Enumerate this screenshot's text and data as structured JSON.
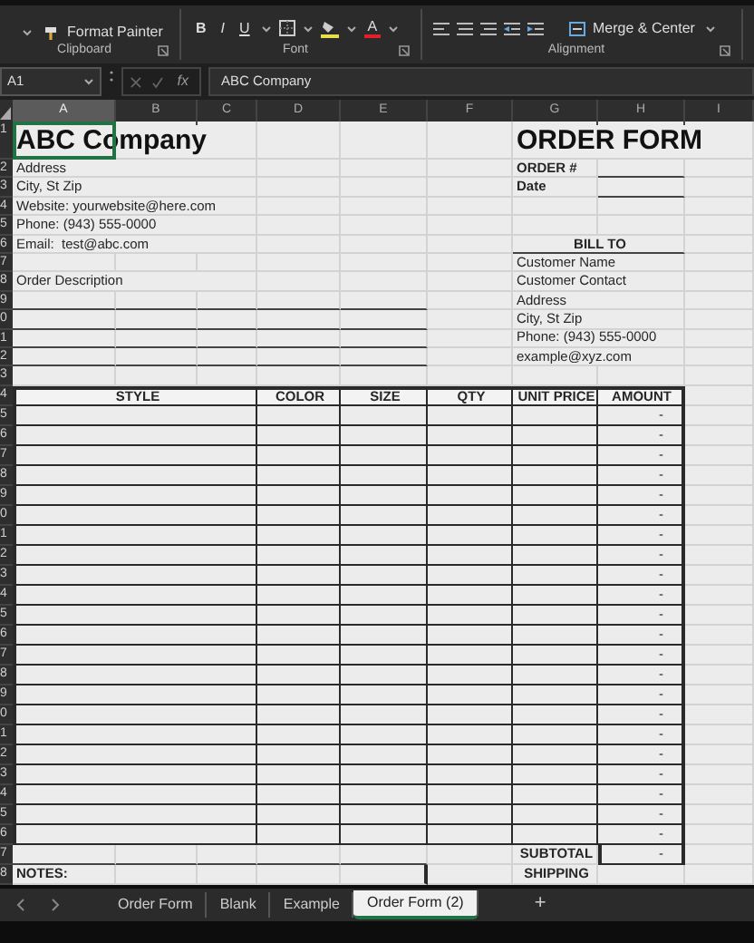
{
  "ribbon": {
    "format_painter": "Format Painter",
    "font_buttons": [
      "B",
      "I",
      "U"
    ],
    "font_color": "A",
    "merge_center": "Merge & Center",
    "groups": [
      "Clipboard",
      "Font",
      "Alignment"
    ]
  },
  "formula_bar": {
    "name_box": "A1",
    "function_label": "fx",
    "value": "ABC Company"
  },
  "columns": [
    {
      "label": "A",
      "selected": true
    },
    {
      "label": "B",
      "selected": false
    },
    {
      "label": "C",
      "selected": false
    },
    {
      "label": "D",
      "selected": false
    },
    {
      "label": "E",
      "selected": false
    },
    {
      "label": "F",
      "selected": false
    },
    {
      "label": "G",
      "selected": false
    },
    {
      "label": "H",
      "selected": false
    },
    {
      "label": "I",
      "selected": false
    }
  ],
  "row_numbers": [
    "1",
    "2",
    "3",
    "4",
    "5",
    "6",
    "7",
    "8",
    "9",
    "0",
    "1",
    "2",
    "3",
    "4",
    "5",
    "6",
    "7",
    "8",
    "9",
    "0",
    "1",
    "2",
    "3",
    "4",
    "5",
    "6",
    "7",
    "8",
    "9",
    "0",
    "1",
    "2",
    "3",
    "4",
    "5",
    "6",
    "7",
    "8"
  ],
  "company": {
    "name": "ABC Company",
    "lines": [
      "Address",
      "City, St Zip",
      "Website: yourwebsite@here.com",
      "Phone: (943) 555-0000",
      "Email:  test@abc.com"
    ]
  },
  "order_description": "Order Description",
  "title": "ORDER FORM",
  "order_fields": [
    "ORDER #",
    "Date"
  ],
  "bill_to": {
    "heading": "BILL TO",
    "lines": [
      "Customer Name",
      "Customer Contact",
      "Address",
      "City, St Zip",
      "Phone: (943) 555-0000",
      "example@xyz.com"
    ]
  },
  "items": {
    "columns": [
      "STYLE",
      "COLOR",
      "SIZE",
      "QTY",
      "UNIT PRICE",
      "AMOUNT"
    ],
    "rows": [
      {
        "amount": "-"
      },
      {
        "amount": "-"
      },
      {
        "amount": "-"
      },
      {
        "amount": "-"
      },
      {
        "amount": "-"
      },
      {
        "amount": "-"
      },
      {
        "amount": "-"
      },
      {
        "amount": "-"
      },
      {
        "amount": "-"
      },
      {
        "amount": "-"
      },
      {
        "amount": "-"
      },
      {
        "amount": "-"
      },
      {
        "amount": "-"
      },
      {
        "amount": "-"
      },
      {
        "amount": "-"
      },
      {
        "amount": "-"
      },
      {
        "amount": "-"
      },
      {
        "amount": "-"
      },
      {
        "amount": "-"
      },
      {
        "amount": "-"
      },
      {
        "amount": "-"
      },
      {
        "amount": "-"
      }
    ]
  },
  "totals": [
    {
      "label": "SUBTOTAL",
      "value": "-"
    },
    {
      "label": "SHIPPING"
    }
  ],
  "notes_label": "NOTES:",
  "sheet_tabs": [
    {
      "label": "Order Form",
      "selected": false
    },
    {
      "label": "Blank",
      "selected": false
    },
    {
      "label": "Example",
      "selected": false
    },
    {
      "label": "Order Form (2)",
      "selected": true
    }
  ],
  "add_sheet": "+"
}
